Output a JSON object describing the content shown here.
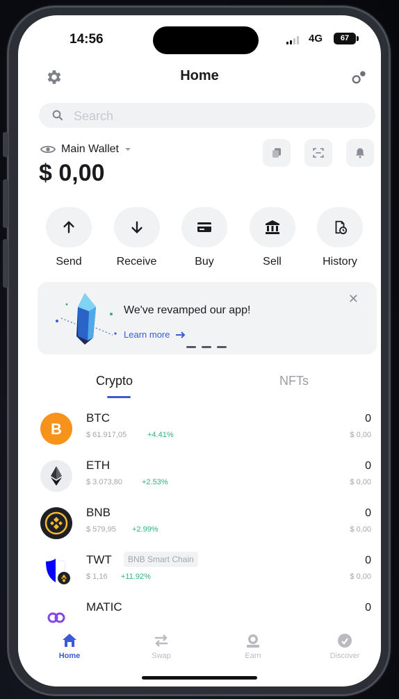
{
  "status_bar": {
    "time": "14:56",
    "network": "4G",
    "battery": "67"
  },
  "header": {
    "title": "Home"
  },
  "search": {
    "placeholder": "Search"
  },
  "wallet": {
    "name": "Main Wallet",
    "balance": "$ 0,00"
  },
  "actions": [
    {
      "label": "Send",
      "icon": "arrow-up-icon"
    },
    {
      "label": "Receive",
      "icon": "arrow-down-icon"
    },
    {
      "label": "Buy",
      "icon": "card-icon"
    },
    {
      "label": "Sell",
      "icon": "bank-icon"
    },
    {
      "label": "History",
      "icon": "history-icon"
    }
  ],
  "promo": {
    "title": "We've revamped our app!",
    "link": "Learn more"
  },
  "tabs": {
    "crypto": "Crypto",
    "nfts": "NFTs"
  },
  "tokens": [
    {
      "symbol": "BTC",
      "price": "$ 61.917,05",
      "change": "+4.41%",
      "amount": "0",
      "value": "$ 0,00",
      "color": "#f7931a"
    },
    {
      "symbol": "ETH",
      "price": "$ 3.073,80",
      "change": "+2.53%",
      "amount": "0",
      "value": "$ 0,00",
      "color": "#ecedf0"
    },
    {
      "symbol": "BNB",
      "price": "$ 579,95",
      "change": "+2.99%",
      "amount": "0",
      "value": "$ 0,00",
      "color": "#1e2026"
    },
    {
      "symbol": "TWT",
      "chain": "BNB Smart Chain",
      "price": "$ 1,16",
      "change": "+11.92%",
      "amount": "0",
      "value": "$ 0,00",
      "color": "#0500ff"
    },
    {
      "symbol": "MATIC",
      "price": "",
      "change": "",
      "amount": "0",
      "value": "",
      "color": "#8247e5"
    }
  ],
  "bottom_nav": [
    {
      "label": "Home",
      "active": true
    },
    {
      "label": "Swap",
      "active": false
    },
    {
      "label": "Earn",
      "active": false
    },
    {
      "label": "Discover",
      "active": false
    }
  ],
  "colors": {
    "accent": "#3c59d9",
    "positive": "#2bb37a",
    "muted": "#a3a5ab"
  }
}
